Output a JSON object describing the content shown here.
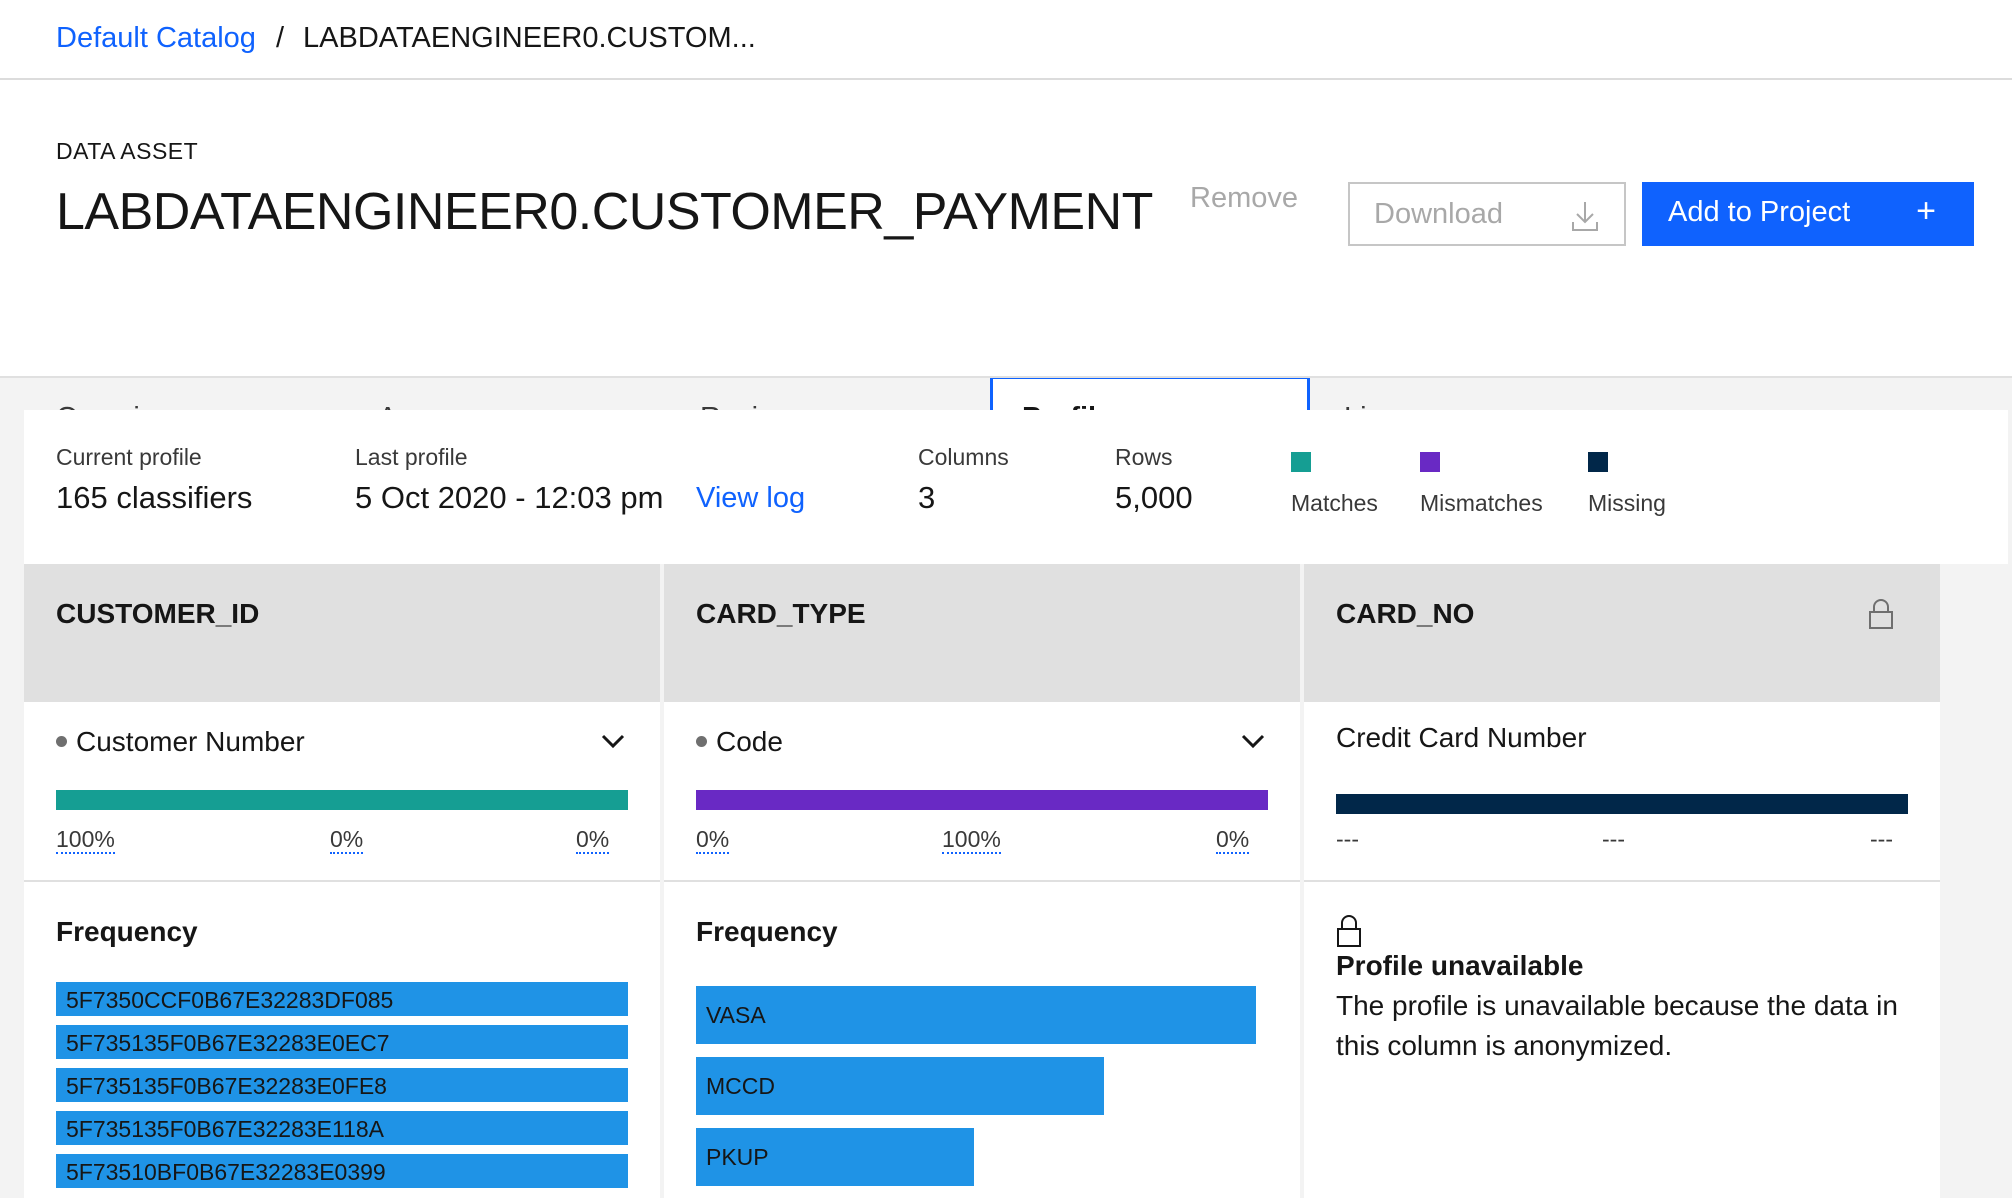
{
  "breadcrumb": {
    "catalog": "Default Catalog",
    "separator": "/",
    "current": "LABDATAENGINEER0.CUSTOM..."
  },
  "header": {
    "asset_type": "DATA ASSET",
    "title": "LABDATAENGINEER0.CUSTOMER_PAYMENT",
    "remove_label": "Remove",
    "download_label": "Download",
    "download_icon": "download-icon",
    "add_label": "Add to Project",
    "add_icon": "+"
  },
  "tabs": [
    {
      "label": "Overview",
      "active": false
    },
    {
      "label": "Access",
      "active": false
    },
    {
      "label": "Review",
      "active": false
    },
    {
      "label": "Profile",
      "active": true
    },
    {
      "label": "Lineage",
      "active": false
    }
  ],
  "summary": {
    "current_profile_label": "Current profile",
    "current_profile_value": "165 classifiers",
    "last_profile_label": "Last profile",
    "last_profile_value": "5 Oct 2020 - 12:03 pm",
    "view_log": "View log",
    "columns_label": "Columns",
    "columns_value": "3",
    "rows_label": "Rows",
    "rows_value": "5,000",
    "legend": [
      {
        "label": "Matches",
        "color": "#159e93"
      },
      {
        "label": "Mismatches",
        "color": "#6929c4"
      },
      {
        "label": "Missing",
        "color": "#012749"
      }
    ]
  },
  "columns": [
    {
      "name": "CUSTOMER_ID",
      "classifier": "Customer Number",
      "bar_color": "#159e93",
      "percents": [
        "100%",
        "0%",
        "0%"
      ],
      "frequency_title": "Frequency",
      "frequency": [
        {
          "label": "5F7350CCF0B67E32283DF085",
          "fraction": 1.0
        },
        {
          "label": "5F735135F0B67E32283E0EC7",
          "fraction": 1.0
        },
        {
          "label": "5F735135F0B67E32283E0FE8",
          "fraction": 1.0
        },
        {
          "label": "5F735135F0B67E32283E118A",
          "fraction": 1.0
        },
        {
          "label": "5F73510BF0B67E32283E0399",
          "fraction": 1.0
        }
      ]
    },
    {
      "name": "CARD_TYPE",
      "classifier": "Code",
      "bar_color": "#6929c4",
      "percents": [
        "0%",
        "100%",
        "0%"
      ],
      "frequency_title": "Frequency",
      "frequency": [
        {
          "label": "VASA",
          "fraction": 1.0
        },
        {
          "label": "MCCD",
          "fraction": 0.728
        },
        {
          "label": "PKUP",
          "fraction": 0.496
        }
      ]
    },
    {
      "name": "CARD_NO",
      "classifier": "Credit Card Number",
      "bar_color": "#012749",
      "percents": [
        "---",
        "---",
        "---"
      ],
      "lock_icon": "lock-icon",
      "unavailable_title": "Profile unavailable",
      "unavailable_text": "The profile is unavailable because the data in this column is anonymized."
    }
  ]
}
